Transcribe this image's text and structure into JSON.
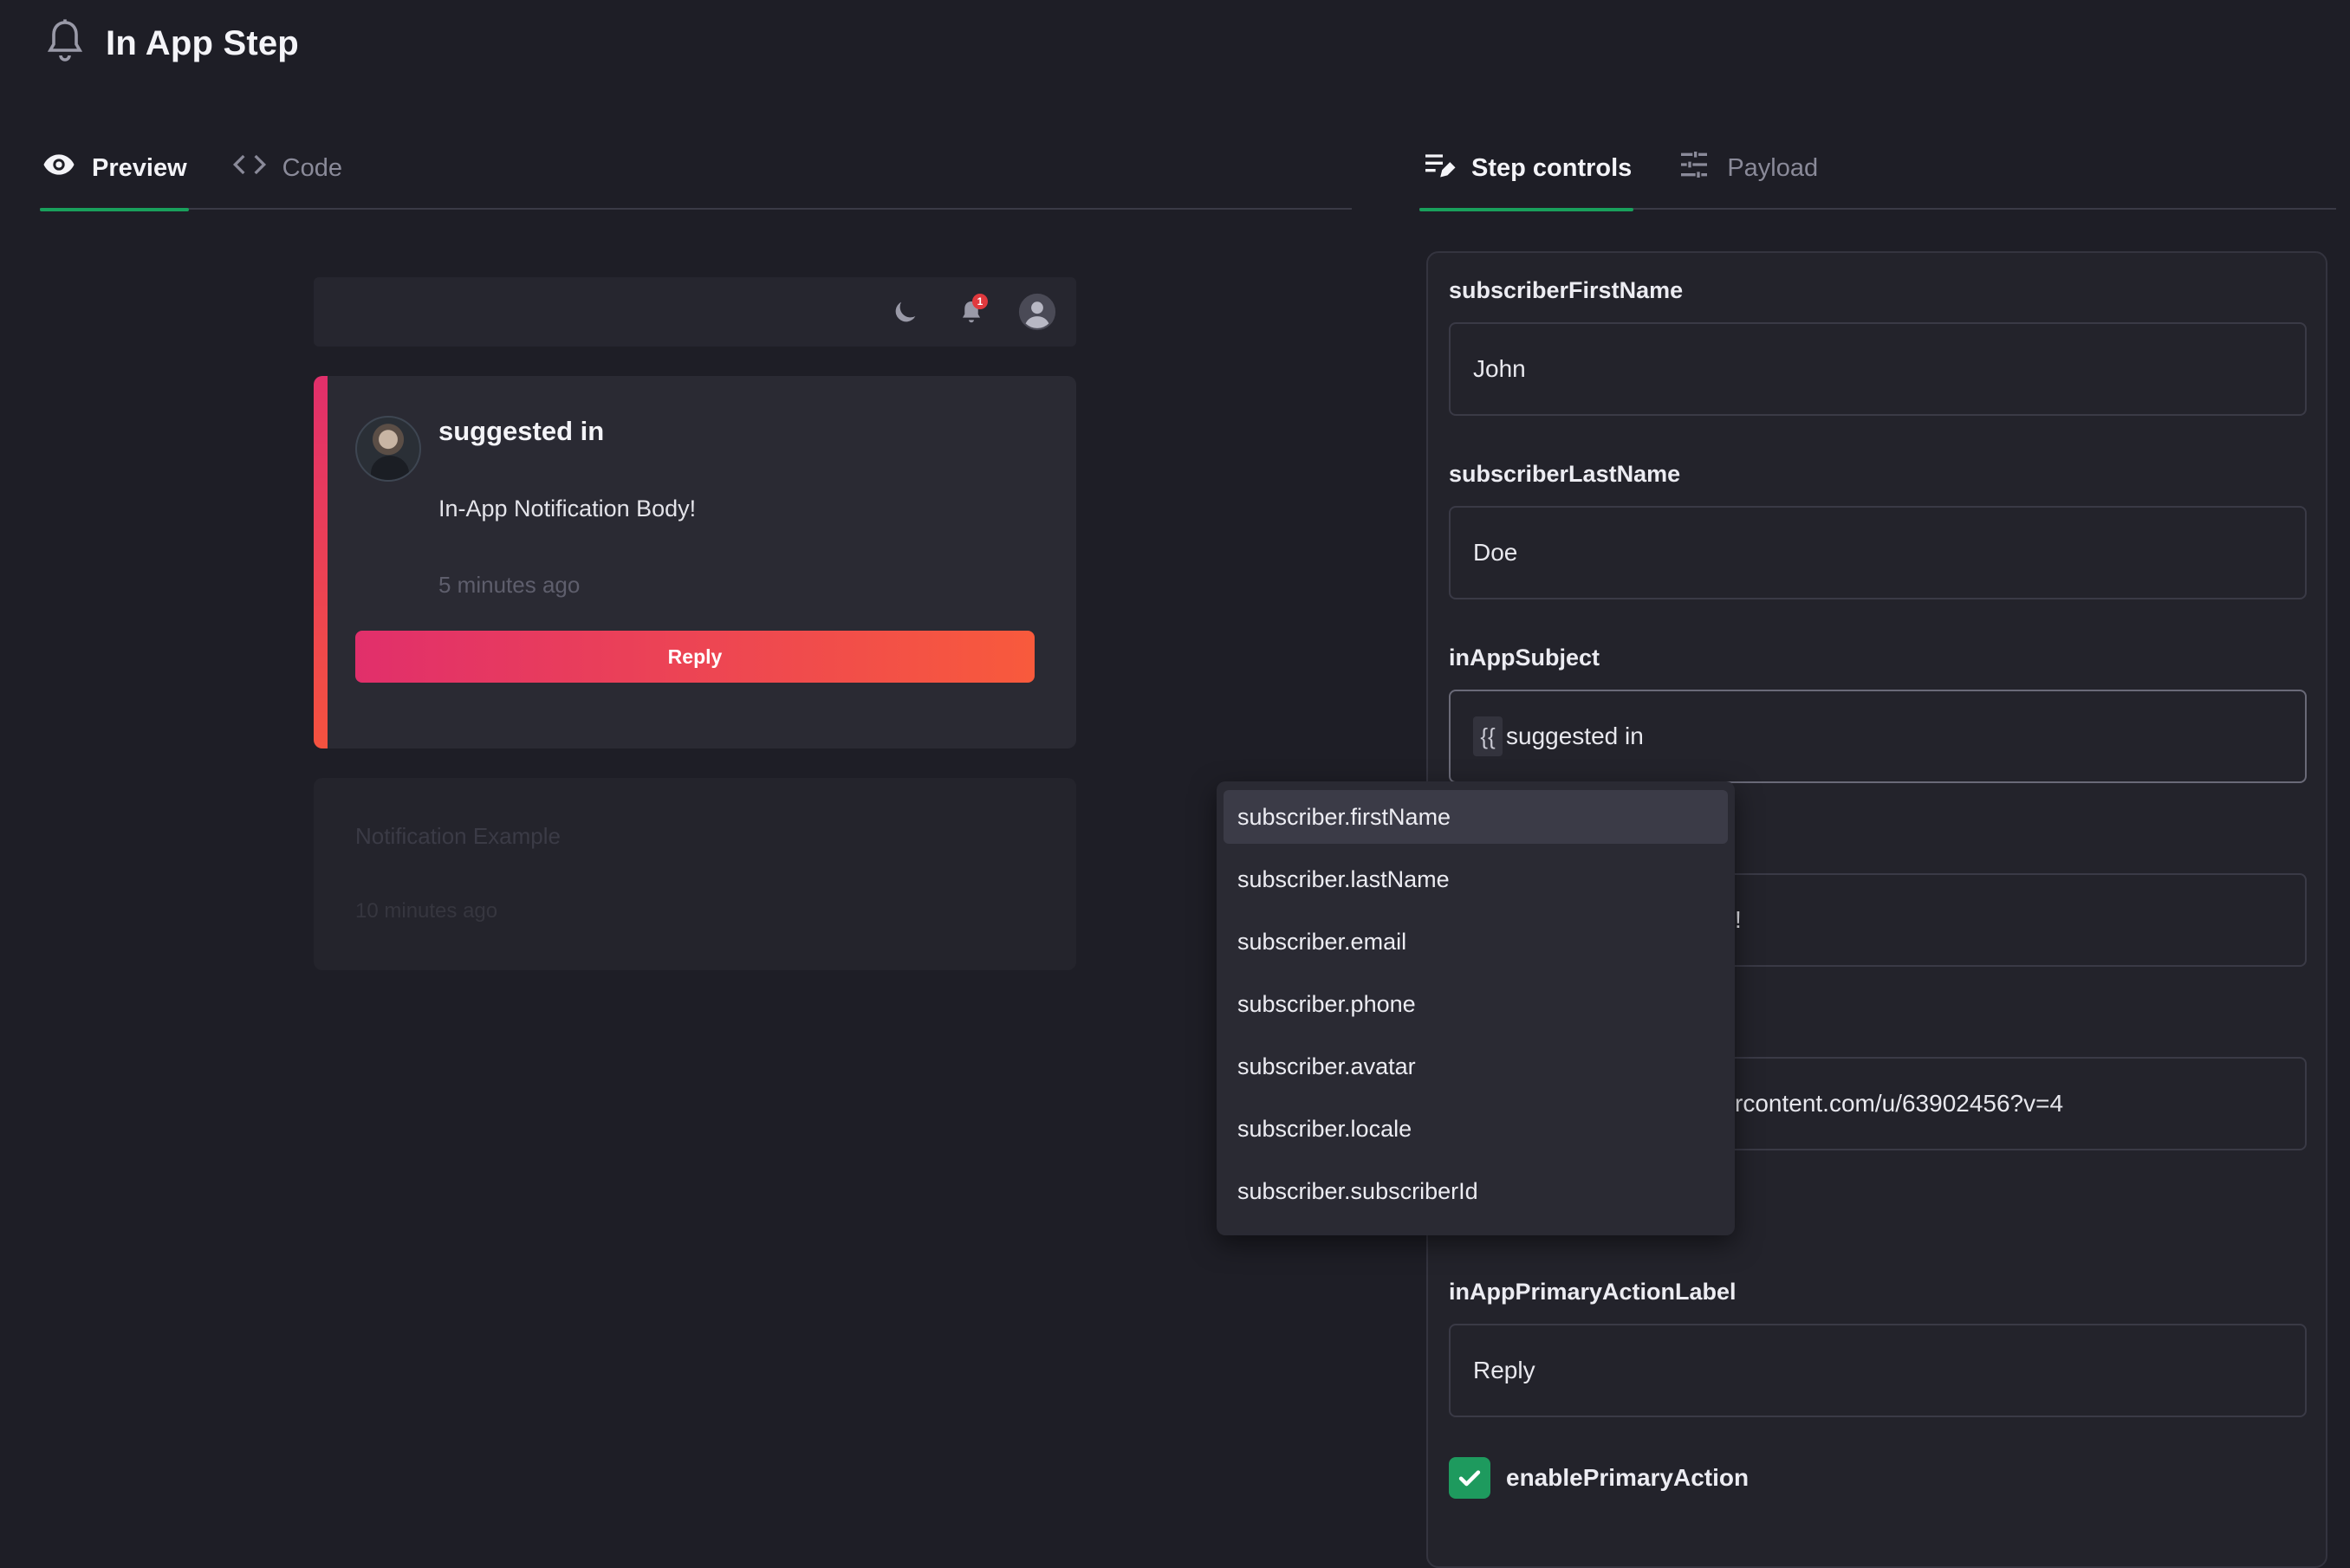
{
  "header": {
    "title": "In App Step",
    "icon": "bell-icon"
  },
  "left_tabs": [
    {
      "label": "Preview",
      "icon": "eye-icon",
      "active": true
    },
    {
      "label": "Code",
      "icon": "code-icon",
      "active": false
    }
  ],
  "right_tabs": [
    {
      "label": "Step controls",
      "icon": "edit-list-icon",
      "active": true
    },
    {
      "label": "Payload",
      "icon": "sliders-icon",
      "active": false
    }
  ],
  "inbox": {
    "badge_count": "1"
  },
  "notification": {
    "subject": "suggested in",
    "body": "In-App Notification Body!",
    "time": "5 minutes ago",
    "action_label": "Reply"
  },
  "notification_example": {
    "title": "Notification Example",
    "time": "10 minutes ago"
  },
  "controls": {
    "subscriberFirstName": {
      "label": "subscriberFirstName",
      "value": "John"
    },
    "subscriberLastName": {
      "label": "subscriberLastName",
      "value": "Doe"
    },
    "inAppSubject": {
      "label": "inAppSubject",
      "brace": "{{",
      "value": "suggested in"
    },
    "inAppBody": {
      "value": "!"
    },
    "inAppAvatar": {
      "value": "rcontent.com/u/63902456?v=4"
    },
    "inAppPrimaryActionLabel": {
      "label": "inAppPrimaryActionLabel",
      "value": "Reply"
    },
    "enablePrimaryAction": {
      "label": "enablePrimaryAction",
      "checked": true
    }
  },
  "dropdown": {
    "items": [
      "subscriber.firstName",
      "subscriber.lastName",
      "subscriber.email",
      "subscriber.phone",
      "subscriber.avatar",
      "subscriber.locale",
      "subscriber.subscriberId"
    ],
    "active_index": 0
  },
  "colors": {
    "accent_green": "#19a05c",
    "gradient_start": "#e12f6b",
    "gradient_end": "#f85a3c",
    "background": "#1e1e26"
  }
}
